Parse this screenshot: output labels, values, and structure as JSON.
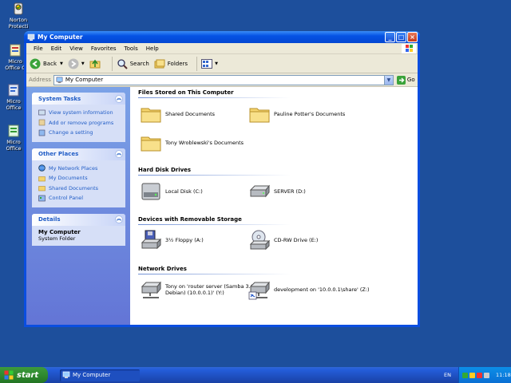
{
  "desktop": {
    "icons": [
      {
        "label_line1": "Norton",
        "label_line2": "Protecti"
      },
      {
        "label_line1": "Micro",
        "label_line2": "Office C"
      },
      {
        "label_line1": "Micro",
        "label_line2": "Office"
      },
      {
        "label_line1": "Micro",
        "label_line2": "Office"
      }
    ]
  },
  "window": {
    "title": "My Computer",
    "menu": [
      "File",
      "Edit",
      "View",
      "Favorites",
      "Tools",
      "Help"
    ],
    "toolbar": {
      "back": "Back",
      "search": "Search",
      "folders": "Folders"
    },
    "address": {
      "label": "Address",
      "value": "My Computer",
      "go": "Go"
    }
  },
  "taskpane": {
    "system_tasks": {
      "title": "System Tasks",
      "links": [
        "View system information",
        "Add or remove programs",
        "Change a setting"
      ]
    },
    "other_places": {
      "title": "Other Places",
      "links": [
        "My Network Places",
        "My Documents",
        "Shared Documents",
        "Control Panel"
      ]
    },
    "details": {
      "title": "Details",
      "name": "My Computer",
      "type": "System Folder"
    }
  },
  "content": {
    "groups": [
      {
        "title": "Files Stored on This Computer",
        "items": [
          "Shared Documents",
          "Pauline Potter's Documents",
          "Tony Wroblewski's Documents"
        ]
      },
      {
        "title": "Hard Disk Drives",
        "items": [
          "Local Disk (C:)",
          "SERVER (D:)"
        ]
      },
      {
        "title": "Devices with Removable Storage",
        "items": [
          "3½ Floppy (A:)",
          "CD-RW Drive (E:)"
        ]
      },
      {
        "title": "Network Drives",
        "items": [
          "Tony on 'router server (Samba 3.0.0-Debian) (10.0.0.1)' (Y:)",
          "development on '10.0.0.1\\share' (Z:)"
        ]
      }
    ]
  },
  "taskbar": {
    "start": "start",
    "task": "My Computer",
    "lang": "EN",
    "clock": "11:18"
  },
  "colors": {
    "desktop": "#1d4f9c",
    "titlebar": "#0552e4",
    "link": "#215dc6"
  }
}
